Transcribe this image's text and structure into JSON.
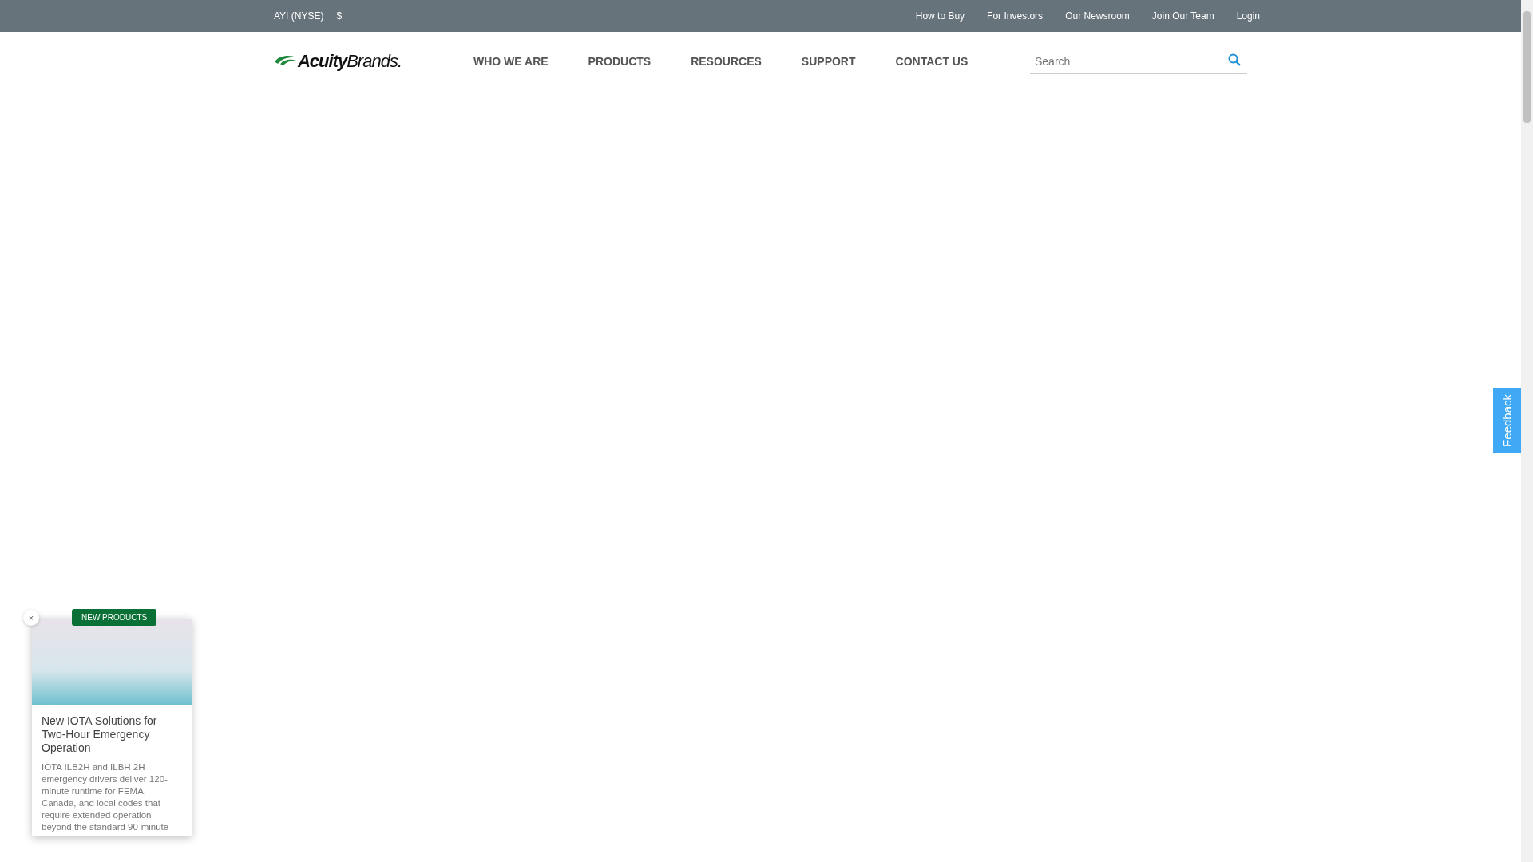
{
  "top_bar": {
    "ticker": "AYI (NYSE)",
    "price": "$",
    "links": [
      "How to Buy",
      "For Investors",
      "Our Newsroom",
      "Join Our Team",
      "Login"
    ]
  },
  "header": {
    "logo": {
      "bold": "Acuity",
      "light": "Brands."
    },
    "nav": [
      {
        "label": "WHO WE ARE"
      },
      {
        "label": "PRODUCTS"
      },
      {
        "label": "RESOURCES"
      },
      {
        "label": "SUPPORT"
      },
      {
        "label": "CONTACT US"
      }
    ],
    "search": {
      "placeholder": "Search"
    }
  },
  "promo": {
    "close": "×",
    "badge": "NEW PRODUCTS",
    "title": "New IOTA Solutions for Two-Hour Emergency Operation",
    "body": "IOTA ILB2H and ILBH 2H emergency drivers deliver 120-minute runtime for FEMA, Canada, and local codes that require extended operation beyond the standard 90-minute"
  },
  "feedback": {
    "label": "Feedback"
  }
}
